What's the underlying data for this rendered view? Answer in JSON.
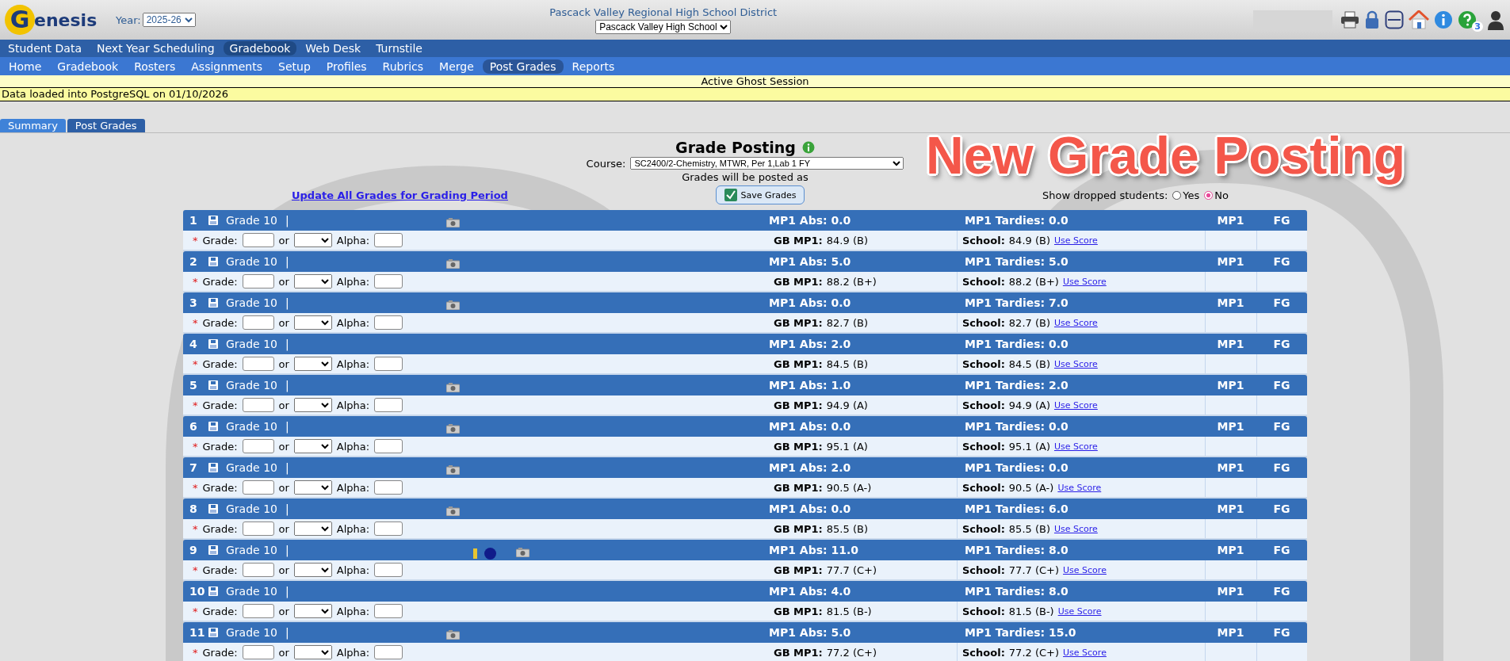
{
  "header": {
    "app_name": "Genesis",
    "year_label": "Year:",
    "year": "2025-26",
    "district": "Pascack Valley Regional High School District",
    "school": "Pascack Valley High School",
    "help_count": "3"
  },
  "main_nav": [
    {
      "label": "Student Data",
      "selected": false
    },
    {
      "label": "Next Year Scheduling",
      "selected": false
    },
    {
      "label": "Gradebook",
      "selected": true
    },
    {
      "label": "Web Desk",
      "selected": false
    },
    {
      "label": "Turnstile",
      "selected": false
    }
  ],
  "sub_nav": [
    {
      "label": "Home",
      "selected": false
    },
    {
      "label": "Gradebook",
      "selected": false
    },
    {
      "label": "Rosters",
      "selected": false
    },
    {
      "label": "Assignments",
      "selected": false
    },
    {
      "label": "Setup",
      "selected": false
    },
    {
      "label": "Profiles",
      "selected": false
    },
    {
      "label": "Rubrics",
      "selected": false
    },
    {
      "label": "Merge",
      "selected": false
    },
    {
      "label": "Post Grades",
      "selected": true
    },
    {
      "label": "Reports",
      "selected": false
    }
  ],
  "session_banner": "Active Ghost Session",
  "data_notice": "Data loaded into PostgreSQL on 01/10/2026",
  "tabs": [
    {
      "label": "Summary",
      "selected": false
    },
    {
      "label": "Post Grades",
      "selected": true
    }
  ],
  "overlay_title": "New Grade Posting",
  "posting": {
    "title": "Grade Posting",
    "course_label": "Course:",
    "course": "SC2400/2-Chemistry, MTWR, Per 1,Lab 1 FY",
    "posted_as": "Grades will be posted as",
    "update_link": "Update All Grades for Grading Period",
    "save_button": "Save Grades",
    "dropped_label": "Show dropped students:",
    "dropped_options": [
      {
        "label": "Yes",
        "selected": false
      },
      {
        "label": "No",
        "selected": true
      }
    ]
  },
  "students": [
    {
      "num": "1",
      "grade_level": "Grade 10",
      "separator": "|",
      "photo": true,
      "alert": false,
      "abs": "MP1 Abs: 0.0",
      "tardies": "MP1 Tardies: 0.0",
      "mp": "MP1",
      "fg": "FG",
      "required": "*",
      "grade_label": "Grade:",
      "or_label": "or",
      "alpha_label": "Alpha:",
      "gb_label": "GB MP1:",
      "gb_value": "84.9 (B)",
      "school_label": "School:",
      "school_value": "84.9 (B)",
      "use_score": "Use Score"
    },
    {
      "num": "2",
      "grade_level": "Grade 10",
      "separator": "|",
      "photo": true,
      "alert": false,
      "abs": "MP1 Abs: 5.0",
      "tardies": "MP1 Tardies: 5.0",
      "mp": "MP1",
      "fg": "FG",
      "required": "*",
      "grade_label": "Grade:",
      "or_label": "or",
      "alpha_label": "Alpha:",
      "gb_label": "GB MP1:",
      "gb_value": "88.2 (B+)",
      "school_label": "School:",
      "school_value": "88.2 (B+)",
      "use_score": "Use Score"
    },
    {
      "num": "3",
      "grade_level": "Grade 10",
      "separator": "|",
      "photo": true,
      "alert": false,
      "abs": "MP1 Abs: 0.0",
      "tardies": "MP1 Tardies: 7.0",
      "mp": "MP1",
      "fg": "FG",
      "required": "*",
      "grade_label": "Grade:",
      "or_label": "or",
      "alpha_label": "Alpha:",
      "gb_label": "GB MP1:",
      "gb_value": "82.7 (B)",
      "school_label": "School:",
      "school_value": "82.7 (B)",
      "use_score": "Use Score"
    },
    {
      "num": "4",
      "grade_level": "Grade 10",
      "separator": "|",
      "photo": false,
      "alert": false,
      "abs": "MP1 Abs: 2.0",
      "tardies": "MP1 Tardies: 0.0",
      "mp": "MP1",
      "fg": "FG",
      "required": "*",
      "grade_label": "Grade:",
      "or_label": "or",
      "alpha_label": "Alpha:",
      "gb_label": "GB MP1:",
      "gb_value": "84.5 (B)",
      "school_label": "School:",
      "school_value": "84.5 (B)",
      "use_score": "Use Score"
    },
    {
      "num": "5",
      "grade_level": "Grade 10",
      "separator": "|",
      "photo": true,
      "alert": false,
      "abs": "MP1 Abs: 1.0",
      "tardies": "MP1 Tardies: 2.0",
      "mp": "MP1",
      "fg": "FG",
      "required": "*",
      "grade_label": "Grade:",
      "or_label": "or",
      "alpha_label": "Alpha:",
      "gb_label": "GB MP1:",
      "gb_value": "94.9 (A)",
      "school_label": "School:",
      "school_value": "94.9 (A)",
      "use_score": "Use Score"
    },
    {
      "num": "6",
      "grade_level": "Grade 10",
      "separator": "|",
      "photo": true,
      "alert": false,
      "abs": "MP1 Abs: 0.0",
      "tardies": "MP1 Tardies: 0.0",
      "mp": "MP1",
      "fg": "FG",
      "required": "*",
      "grade_label": "Grade:",
      "or_label": "or",
      "alpha_label": "Alpha:",
      "gb_label": "GB MP1:",
      "gb_value": "95.1 (A)",
      "school_label": "School:",
      "school_value": "95.1 (A)",
      "use_score": "Use Score"
    },
    {
      "num": "7",
      "grade_level": "Grade 10",
      "separator": "|",
      "photo": true,
      "alert": false,
      "abs": "MP1 Abs: 2.0",
      "tardies": "MP1 Tardies: 0.0",
      "mp": "MP1",
      "fg": "FG",
      "required": "*",
      "grade_label": "Grade:",
      "or_label": "or",
      "alpha_label": "Alpha:",
      "gb_label": "GB MP1:",
      "gb_value": "90.5 (A-)",
      "school_label": "School:",
      "school_value": "90.5 (A-)",
      "use_score": "Use Score"
    },
    {
      "num": "8",
      "grade_level": "Grade 10",
      "separator": "|",
      "photo": true,
      "alert": false,
      "abs": "MP1 Abs: 0.0",
      "tardies": "MP1 Tardies: 6.0",
      "mp": "MP1",
      "fg": "FG",
      "required": "*",
      "grade_label": "Grade:",
      "or_label": "or",
      "alpha_label": "Alpha:",
      "gb_label": "GB MP1:",
      "gb_value": "85.5 (B)",
      "school_label": "School:",
      "school_value": "85.5 (B)",
      "use_score": "Use Score"
    },
    {
      "num": "9",
      "grade_level": "Grade 10",
      "separator": "|",
      "photo": true,
      "alert": true,
      "abs": "MP1 Abs: 11.0",
      "tardies": "MP1 Tardies: 8.0",
      "mp": "MP1",
      "fg": "FG",
      "required": "*",
      "grade_label": "Grade:",
      "or_label": "or",
      "alpha_label": "Alpha:",
      "gb_label": "GB MP1:",
      "gb_value": "77.7 (C+)",
      "school_label": "School:",
      "school_value": "77.7 (C+)",
      "use_score": "Use Score"
    },
    {
      "num": "10",
      "grade_level": "Grade 10",
      "separator": "|",
      "photo": false,
      "alert": false,
      "abs": "MP1 Abs: 4.0",
      "tardies": "MP1 Tardies: 8.0",
      "mp": "MP1",
      "fg": "FG",
      "required": "*",
      "grade_label": "Grade:",
      "or_label": "or",
      "alpha_label": "Alpha:",
      "gb_label": "GB MP1:",
      "gb_value": "81.5 (B-)",
      "school_label": "School:",
      "school_value": "81.5 (B-)",
      "use_score": "Use Score"
    },
    {
      "num": "11",
      "grade_level": "Grade 10",
      "separator": "|",
      "photo": true,
      "alert": false,
      "abs": "MP1 Abs: 5.0",
      "tardies": "MP1 Tardies: 15.0",
      "mp": "MP1",
      "fg": "FG",
      "required": "*",
      "grade_label": "Grade:",
      "or_label": "or",
      "alpha_label": "Alpha:",
      "gb_label": "GB MP1:",
      "gb_value": "77.2 (C+)",
      "school_label": "School:",
      "school_value": "77.2 (C+)",
      "use_score": "Use Score"
    }
  ]
}
